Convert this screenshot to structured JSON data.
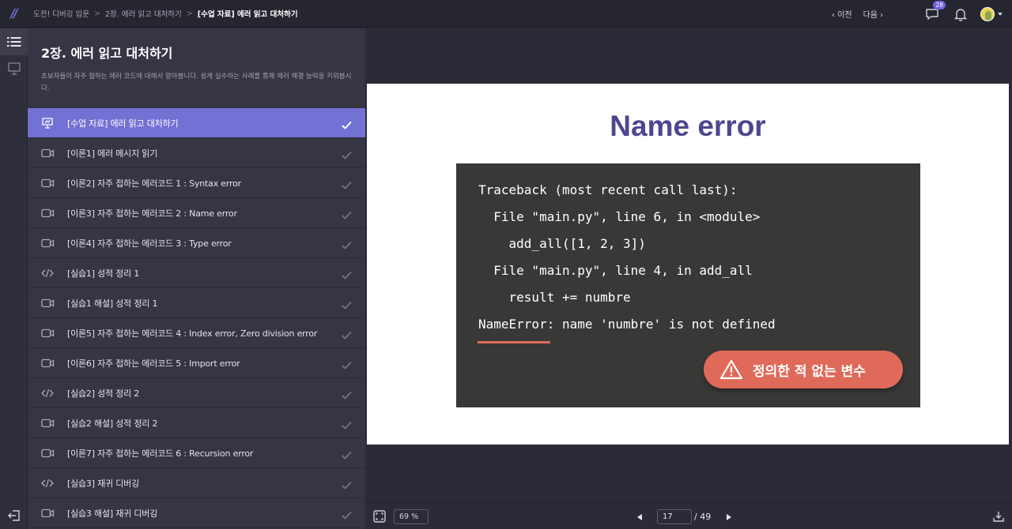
{
  "breadcrumb": {
    "items": [
      "도전! 디버깅 입문",
      "2장. 에러 읽고 대처하기",
      "[수업 자료] 에러 읽고 대처하기"
    ]
  },
  "nav": {
    "prev": "이전",
    "next": "다음"
  },
  "notifications": {
    "message_count": "28"
  },
  "chapter": {
    "title": "2장. 에러 읽고 대처하기",
    "description": "초보자들이 자주 접하는 에러 코드에 대해서 알아봅니다. 쉽게 실수하는 사례를 통해 에러 해결 능력을 키워봅시다."
  },
  "lessons": [
    {
      "label": "[수업 자료] 에러 읽고 대처하기",
      "icon": "presentation-icon",
      "active": true,
      "done": true
    },
    {
      "label": "[이론1] 에러 메시지 읽기",
      "icon": "video-icon",
      "active": false,
      "done": true
    },
    {
      "label": "[이론2] 자주 접하는 에러코드 1 : Syntax error",
      "icon": "video-icon",
      "active": false,
      "done": true
    },
    {
      "label": "[이론3] 자주 접하는 에러코드 2 : Name error",
      "icon": "video-icon",
      "active": false,
      "done": true
    },
    {
      "label": "[이론4] 자주 접하는 에러코드 3 : Type error",
      "icon": "video-icon",
      "active": false,
      "done": true
    },
    {
      "label": "[실습1] 성적 정리 1",
      "icon": "code-icon",
      "active": false,
      "done": true
    },
    {
      "label": "[실습1 해설] 성적 정리 1",
      "icon": "video-icon",
      "active": false,
      "done": true
    },
    {
      "label": "[이론5] 자주 접하는 에러코드 4 : Index error, Zero division error",
      "icon": "video-icon",
      "active": false,
      "done": true
    },
    {
      "label": "[이론6] 자주 접하는 에러코드 5 : Import error",
      "icon": "video-icon",
      "active": false,
      "done": true
    },
    {
      "label": "[실습2] 성적 정리 2",
      "icon": "code-icon",
      "active": false,
      "done": true
    },
    {
      "label": "[실습2 해설] 성적 정리 2",
      "icon": "video-icon",
      "active": false,
      "done": true
    },
    {
      "label": "[이론7] 자주 접하는 에러코드 6 : Recursion error",
      "icon": "video-icon",
      "active": false,
      "done": true
    },
    {
      "label": "[실습3] 재귀 디버깅",
      "icon": "code-icon",
      "active": false,
      "done": true
    },
    {
      "label": "[실습3 해설] 재귀 디버깅",
      "icon": "video-icon",
      "active": false,
      "done": true
    }
  ],
  "slide": {
    "title": "Name error",
    "code_lines": [
      "Traceback (most recent call last):",
      "  File \"main.py\", line 6, in <module>",
      "    add_all([1, 2, 3])",
      "  File \"main.py\", line 4, in add_all",
      "    result += numbre",
      "NameError: name 'numbre' is not defined"
    ],
    "callout": "정의한 적 없는 변수"
  },
  "toolbar": {
    "zoom": "69 %",
    "current_page": "17",
    "total_pages": "/ 49"
  },
  "colors": {
    "accent": "#7471d4",
    "slide_title": "#4a4890",
    "callout": "#e06a5a",
    "code_bg": "#383837"
  }
}
